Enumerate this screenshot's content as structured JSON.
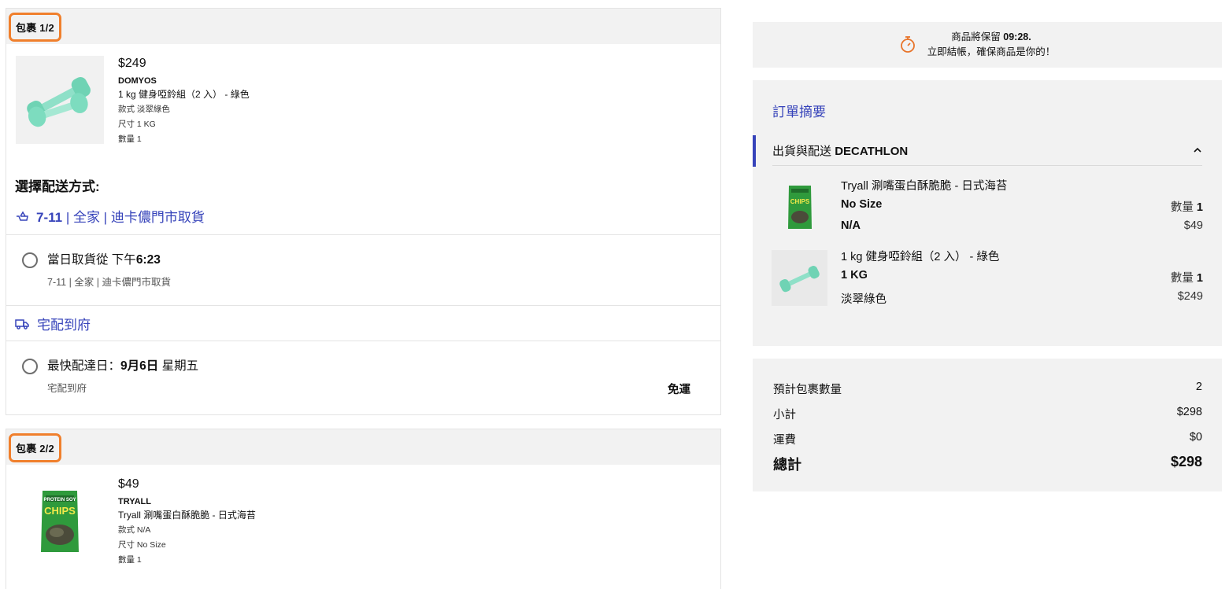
{
  "timer": {
    "line1_prefix": "商品將保留",
    "time": "09:28.",
    "line2": "立即結帳，確保商品是你的！"
  },
  "packages": [
    {
      "badge": "包裹 1/2",
      "product": {
        "price": "$249",
        "brand": "DOMYOS",
        "name": "1 kg 健身啞鈴組（2 入） - 綠色",
        "style": "款式 淡翠綠色",
        "size": "尺寸 1 KG",
        "qty": "數量 1"
      },
      "delivery_title": "選擇配送方式:",
      "pickup_method": {
        "bold": "7-11",
        "rest": " | 全家 | 迪卡儂門市取貨",
        "icon": "pickup-hand-icon"
      },
      "pickup_option": {
        "title_prefix": "當日取貨從 下午",
        "title_time": "6:23",
        "sub": "7-11 | 全家 | 迪卡儂門市取貨"
      },
      "home_method": {
        "label": "宅配到府",
        "icon": "truck-icon"
      },
      "home_option": {
        "title_prefix": "最快配達日：",
        "title_date": "9月6日",
        "title_suffix": "星期五",
        "sub": "宅配到府",
        "fee": "免運"
      }
    },
    {
      "badge": "包裹 2/2",
      "product": {
        "price": "$49",
        "brand": "TRYALL",
        "name": "Tryall 涮嘴蛋白酥脆脆 - 日式海苔",
        "style": "款式 N/A",
        "size": "尺寸 No Size",
        "qty": "數量 1"
      }
    }
  ],
  "summary": {
    "title": "訂單摘要",
    "ship_label": "出貨與配送",
    "ship_brand": "DECATHLON",
    "items": [
      {
        "name": "Tryall 涮嘴蛋白酥脆脆 - 日式海苔",
        "size": "No Size",
        "style": "N/A",
        "qty_label": "數量",
        "qty": "1",
        "price": "$49"
      },
      {
        "name": "1 kg 健身啞鈴組（2 入） - 綠色",
        "size": "1 KG",
        "style": "淡翠綠色",
        "qty_label": "數量",
        "qty": "1",
        "price": "$249"
      }
    ]
  },
  "totals": {
    "packages_label": "預計包裹數量",
    "packages_value": "2",
    "subtotal_label": "小計",
    "subtotal_value": "$298",
    "shipping_label": "運費",
    "shipping_value": "$0",
    "total_label": "總計",
    "total_value": "$298"
  },
  "colors": {
    "accent": "#3643ba",
    "badge_border": "#f07f2c",
    "timer_icon": "#e8742a",
    "product_mint": "#7fdcc0"
  }
}
